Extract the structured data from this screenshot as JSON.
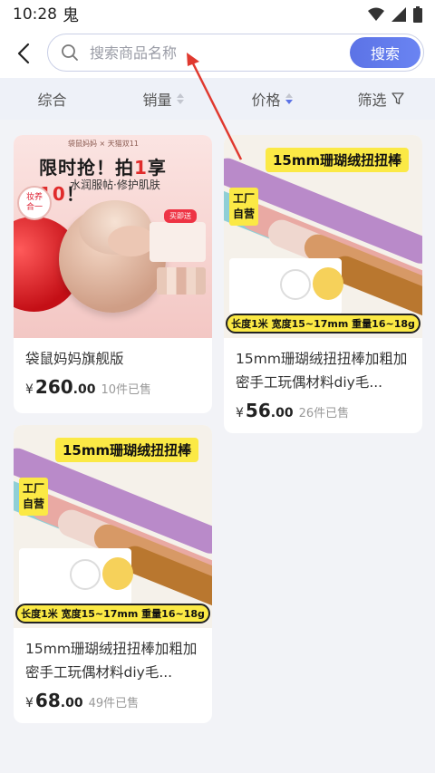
{
  "status_bar": {
    "time": "10:28",
    "app_icon": "鬼"
  },
  "search": {
    "placeholder": "搜索商品名称",
    "value": "",
    "button_label": "搜索"
  },
  "sort_tabs": [
    {
      "label": "综合"
    },
    {
      "label": "销量"
    },
    {
      "label": "价格"
    },
    {
      "label": "筛选"
    }
  ],
  "products": [
    {
      "title": "袋鼠妈妈旗舰版",
      "currency": "¥",
      "price_int": "260",
      "price_dec": ".00",
      "sold": "10件已售",
      "image": {
        "brand": "袋鼠妈妈 × 天猫双11",
        "headline_a": "限时抢！拍",
        "headline_b": "1",
        "headline_c": "享",
        "headline_d": "10",
        "headline_e": "！",
        "sub": "水润服帖·修护肌肤",
        "badge": "妆养\n合一",
        "kit_label": "买即送"
      }
    },
    {
      "title": "15mm珊瑚绒扭扭棒加粗加密手工玩偶材料diy毛...",
      "currency": "¥",
      "price_int": "56",
      "price_dec": ".00",
      "sold": "26件已售",
      "image": {
        "title": "15mm珊瑚绒扭扭棒",
        "tag": "工厂\n自营",
        "bottom": "长度1米  宽度15~17mm  重量16~18g"
      }
    },
    {
      "title": "15mm珊瑚绒扭扭棒加粗加密手工玩偶材料diy毛...",
      "currency": "¥",
      "price_int": "68",
      "price_dec": ".00",
      "sold": "49件已售",
      "image": {
        "title": "15mm珊瑚绒扭扭棒",
        "tag": "工厂\n自营",
        "bottom": "长度1米  宽度15~17mm  重量16~18g"
      }
    }
  ],
  "colors": {
    "accent": "#5c73e6",
    "annotation_arrow": "#e0392f",
    "background": "#f2f3f7"
  }
}
